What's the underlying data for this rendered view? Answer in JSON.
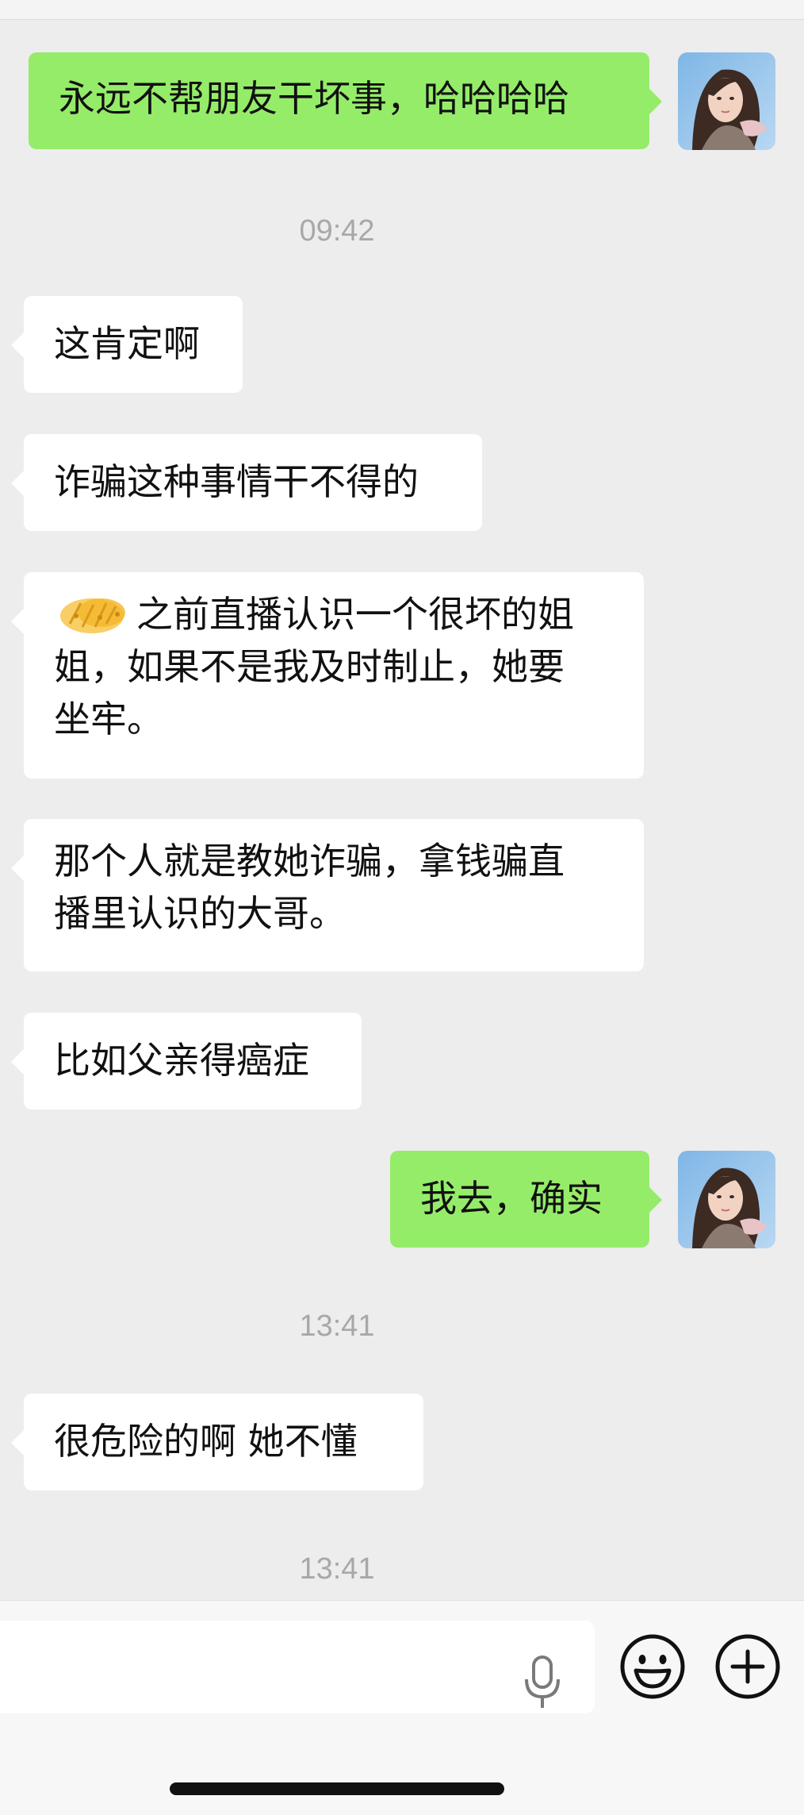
{
  "messages": [
    {
      "id": "m1",
      "sender": "me",
      "text": "永远不帮朋友干坏事，哈哈哈哈"
    },
    {
      "id": "t1",
      "timestamp": "09:42"
    },
    {
      "id": "m2",
      "sender": "other",
      "text": "这肯定啊"
    },
    {
      "id": "m3",
      "sender": "other",
      "text": "诈骗这种事情干不得的"
    },
    {
      "id": "m4",
      "sender": "other",
      "line1": "之前直播认识一个很坏的姐",
      "line2": "姐，如果不是我及时制止，她要",
      "line3": "坐牢。"
    },
    {
      "id": "m5",
      "sender": "other",
      "line1": "那个人就是教她诈骗，拿钱骗直",
      "line2": "播里认识的大哥。"
    },
    {
      "id": "m6",
      "sender": "other",
      "text": "比如父亲得癌症"
    },
    {
      "id": "m7",
      "sender": "me",
      "text": "我去，确实"
    },
    {
      "id": "t2",
      "timestamp": "13:41"
    },
    {
      "id": "m8",
      "sender": "other",
      "text": "很危险的啊 她不懂"
    },
    {
      "id": "t3",
      "timestamp": "13:41"
    }
  ],
  "icons": {
    "sticker": "sticker-emoji-icon",
    "voice": "microphone-icon",
    "emoji": "smiley-face-icon",
    "more": "plus-circle-icon"
  },
  "colors": {
    "background": "#ededed",
    "outgoing_bubble": "#95ec69",
    "incoming_bubble": "#ffffff",
    "timestamp_text": "#a8a8a8"
  }
}
